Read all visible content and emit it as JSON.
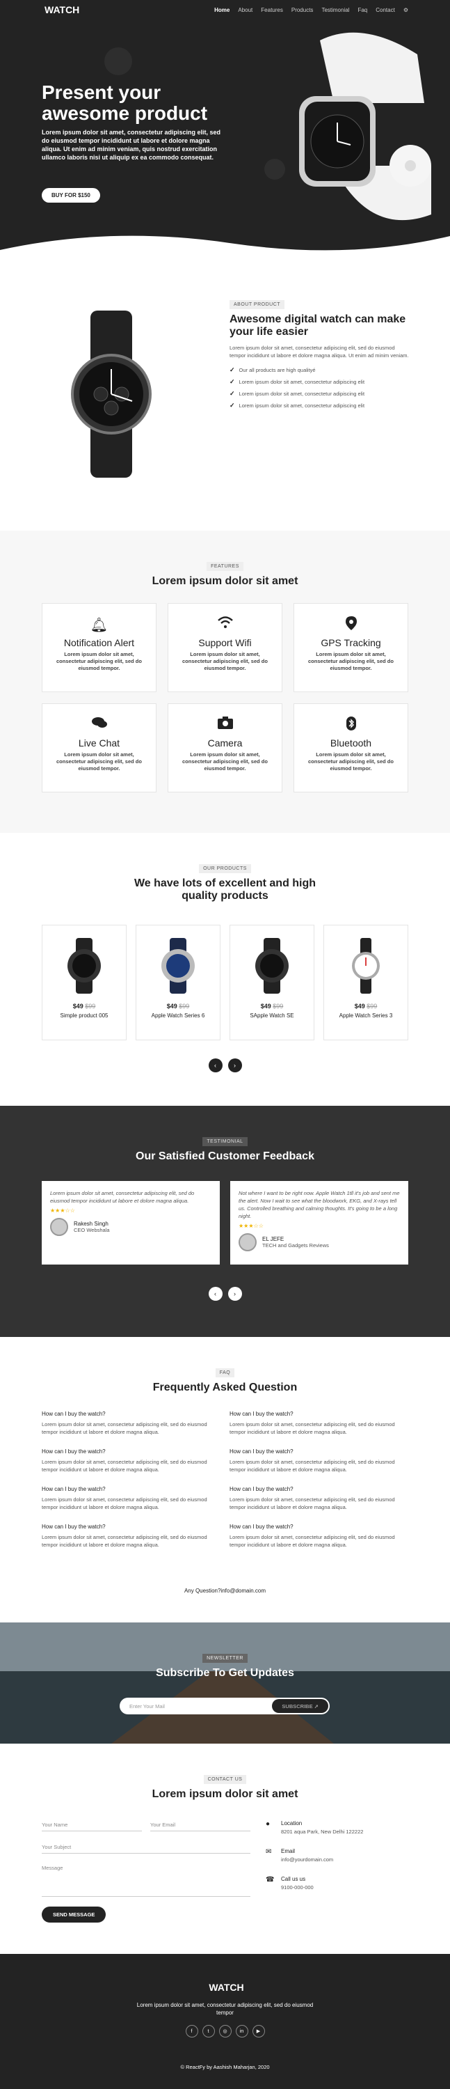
{
  "nav": {
    "brand": "WATCH",
    "items": [
      "Home",
      "About",
      "Features",
      "Products",
      "Testimonial",
      "Faq",
      "Contact"
    ]
  },
  "hero": {
    "title": "Present your awesome product",
    "text": "Lorem ipsum dolor sit amet, consectetur adipiscing elit, sed do eiusmod tempor incididunt ut labore et dolore magna aliqua. Ut enim ad minim veniam, quis nostrud exercitation ullamco laboris nisi ut aliquip ex ea commodo consequat.",
    "button": "BUY FOR $150"
  },
  "about": {
    "tag": "ABOUT PRODUCT",
    "title": "Awesome digital watch can make your life easier",
    "text": "Lorem ipsum dolor sit amet, consectetur adipiscing elit, sed do eiusmod tempor incididunt ut labore et dolore magna aliqua. Ut enim ad minim veniam.",
    "list": [
      "Our all products are high qualityé",
      "Lorem ipsum dolor sit amet, consectetur adipiscing elit",
      "Lorem ipsum dolor sit amet, consectetur adipiscing elit",
      "Lorem ipsum dolor sit amet, consectetur adipiscing elit"
    ]
  },
  "features": {
    "tag": "FEATURES",
    "title": "Lorem ipsum dolor sit amet",
    "text": "Lorem ipsum dolor sit amet, consectetur adipiscing elit, sed do eiusmod tempor.",
    "items": [
      "Notification Alert",
      "Support Wifi",
      "GPS Tracking",
      "Live Chat",
      "Camera",
      "Bluetooth"
    ]
  },
  "products": {
    "tag": "OUR PRODUCTS",
    "title": "We have lots of excellent and high quality products",
    "items": [
      {
        "price": "$49",
        "old": "$99",
        "name": "Simple product 005"
      },
      {
        "price": "$49",
        "old": "$99",
        "name": "Apple Watch Series 6"
      },
      {
        "price": "$49",
        "old": "$99",
        "name": "SApple Watch SE"
      },
      {
        "price": "$49",
        "old": "$99",
        "name": "Apple Watch Series 3"
      }
    ]
  },
  "testimonial": {
    "tag": "TESTIMONIAL",
    "title": "Our Satisfied Customer Feedback",
    "items": [
      {
        "quote": "Lorem ipsum dolor sit amet, consectetur adipiscing elit, sed do eiusmod tempor incididunt ut labore et dolore magna aliqua.",
        "name": "Rakesh Singh",
        "role": "CEO Webshala"
      },
      {
        "quote": "Not where I want to be right now. Apple Watch 1tll it's job and sent me the alert. Now I wait to see what the bloodwork, EKG, and X-rays tell us. Controlled breathing and calming thoughts. It's going to be a long night.",
        "name": "EL JEFE",
        "role": "TECH and Gadgets Reviews"
      }
    ]
  },
  "faq": {
    "tag": "FAQ",
    "title": "Frequently Asked Question",
    "question": "How can I buy the watch?",
    "answer": "Lorem ipsum dolor sit amet, consectetur adipiscing elit, sed do eiusmod tempor incididunt ut labore et dolore magna aliqua.",
    "footer": "Any Question?info@domain.com"
  },
  "newsletter": {
    "tag": "NEWSLETTER",
    "title": "Subscribe To Get Updates",
    "placeholder": "Enter Your Mail",
    "button": "SUBSCRIBE"
  },
  "contact": {
    "tag": "CONTACT US",
    "title": "Lorem ipsum dolor sit amet",
    "name": "Your Name",
    "email": "Your Email",
    "subject": "Your Subject",
    "message": "Message",
    "button": "SEND MESSAGE",
    "location_label": "Location",
    "location": "8201 aqua Park, New Delhi 122222",
    "email_label": "Email",
    "email_value": "info@yourdomain.com",
    "call_label": "Call us us",
    "call_value": "9100-000-000"
  },
  "footer": {
    "brand": "WATCH",
    "text": "Lorem ipsum dolor sit amet, consectetur adipiscing elit, sed do eiusmod tempor",
    "copyright": "© ReactFy by Aashish Maharjan, 2020"
  }
}
